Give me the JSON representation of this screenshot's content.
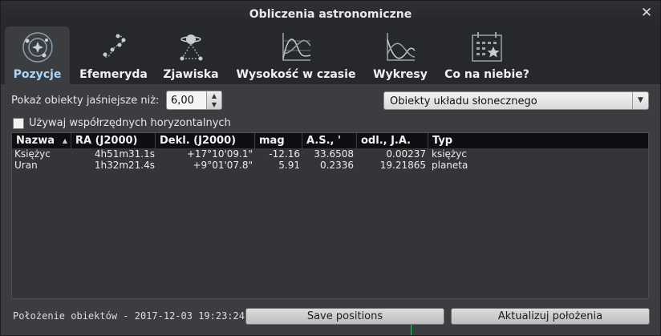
{
  "window": {
    "title": "Obliczenia astronomiczne"
  },
  "tabs": [
    {
      "label": "Pozycje",
      "icon": "solar-system-icon",
      "active": true
    },
    {
      "label": "Efemeryda",
      "icon": "ephemeris-icon"
    },
    {
      "label": "Zjawiska",
      "icon": "phenomena-icon"
    },
    {
      "label": "Wysokość w czasie",
      "icon": "altitude-graph-icon"
    },
    {
      "label": "Wykresy",
      "icon": "graphs-icon"
    },
    {
      "label": "Co na niebie?",
      "icon": "calendar-star-icon"
    }
  ],
  "filters": {
    "magnitude_label": "Pokaż obiekty jaśniejsze niż:",
    "magnitude_value": "6,00",
    "object_type": "Obiekty układu słonecznego",
    "horizontal_coords_label": "Używaj współrzędnych horyzontalnych",
    "horizontal_coords_checked": false
  },
  "table": {
    "columns": [
      "Nazwa",
      "RA (J2000)",
      "Dekl. (J2000)",
      "mag",
      "A.S., '",
      "odl., J.A.",
      "Typ"
    ],
    "sort_column": "Nazwa",
    "rows": [
      [
        "Księżyc",
        "4h51m31.1s",
        "+17°10'09.1\"",
        "-12.16",
        "33.6508",
        "0.00237",
        "księżyc"
      ],
      [
        "Uran",
        "1h32m21.4s",
        "+9°01'07.8\"",
        "5.91",
        "0.2336",
        "19.21865",
        "planeta"
      ]
    ]
  },
  "footer": {
    "status": "Położenie obiektów - 2017-12-03 19:23:24",
    "save_button": "Save positions",
    "update_button": "Aktualizuj położenia"
  },
  "colors": {
    "active_tab_label": "#a9d7ff",
    "window_bg": "#3b3d40",
    "header_bg": "#0e0f11"
  }
}
